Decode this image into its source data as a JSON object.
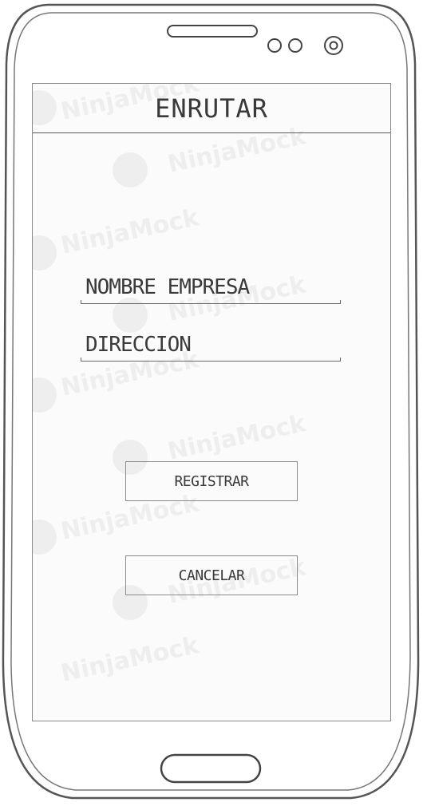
{
  "screen": {
    "title": "ENRUTAR",
    "watermark": "NinjaMock"
  },
  "form": {
    "company_name_label": "NOMBRE EMPRESA",
    "address_label": "DIRECCION"
  },
  "actions": {
    "register_label": "REGISTRAR",
    "cancel_label": "CANCELAR"
  },
  "device": {
    "icons": [
      "speaker-grille",
      "front-sensor",
      "front-camera",
      "home-button"
    ]
  },
  "colors": {
    "outline": "#5a5a5a",
    "text": "#3a3a3a",
    "watermark": "#eeeeee"
  }
}
